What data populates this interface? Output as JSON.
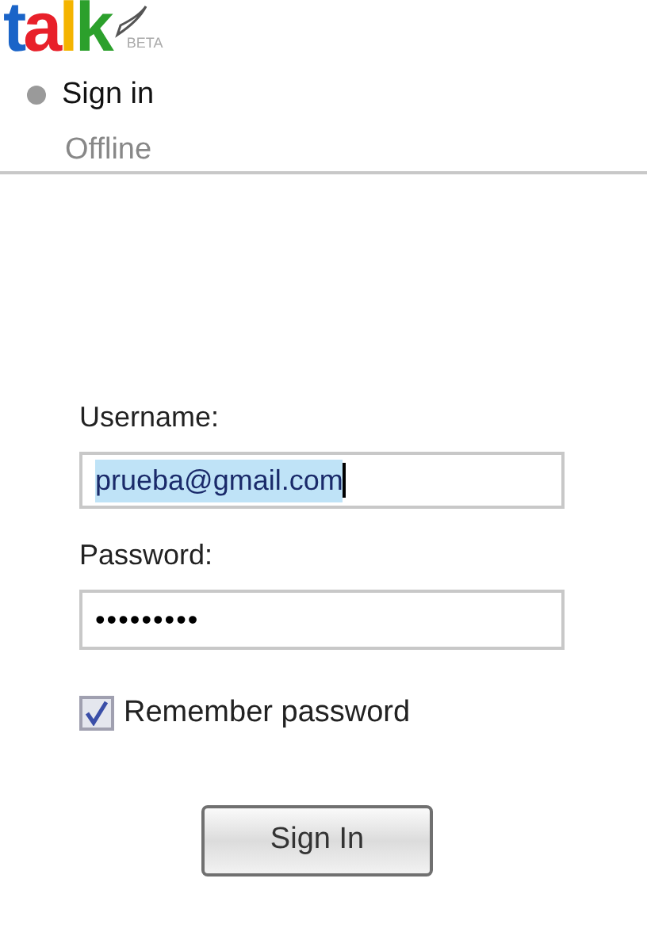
{
  "logo": {
    "text": "talk",
    "badge": "BETA"
  },
  "status": {
    "title": "Sign in",
    "subtitle": "Offline",
    "online": false
  },
  "form": {
    "username_label": "Username:",
    "username": "prueba@gmail.com",
    "username_selected": true,
    "password_label": "Password:",
    "password": "•••••••••",
    "remember": {
      "label": "Remember password",
      "checked": true
    },
    "submit": "Sign In"
  }
}
